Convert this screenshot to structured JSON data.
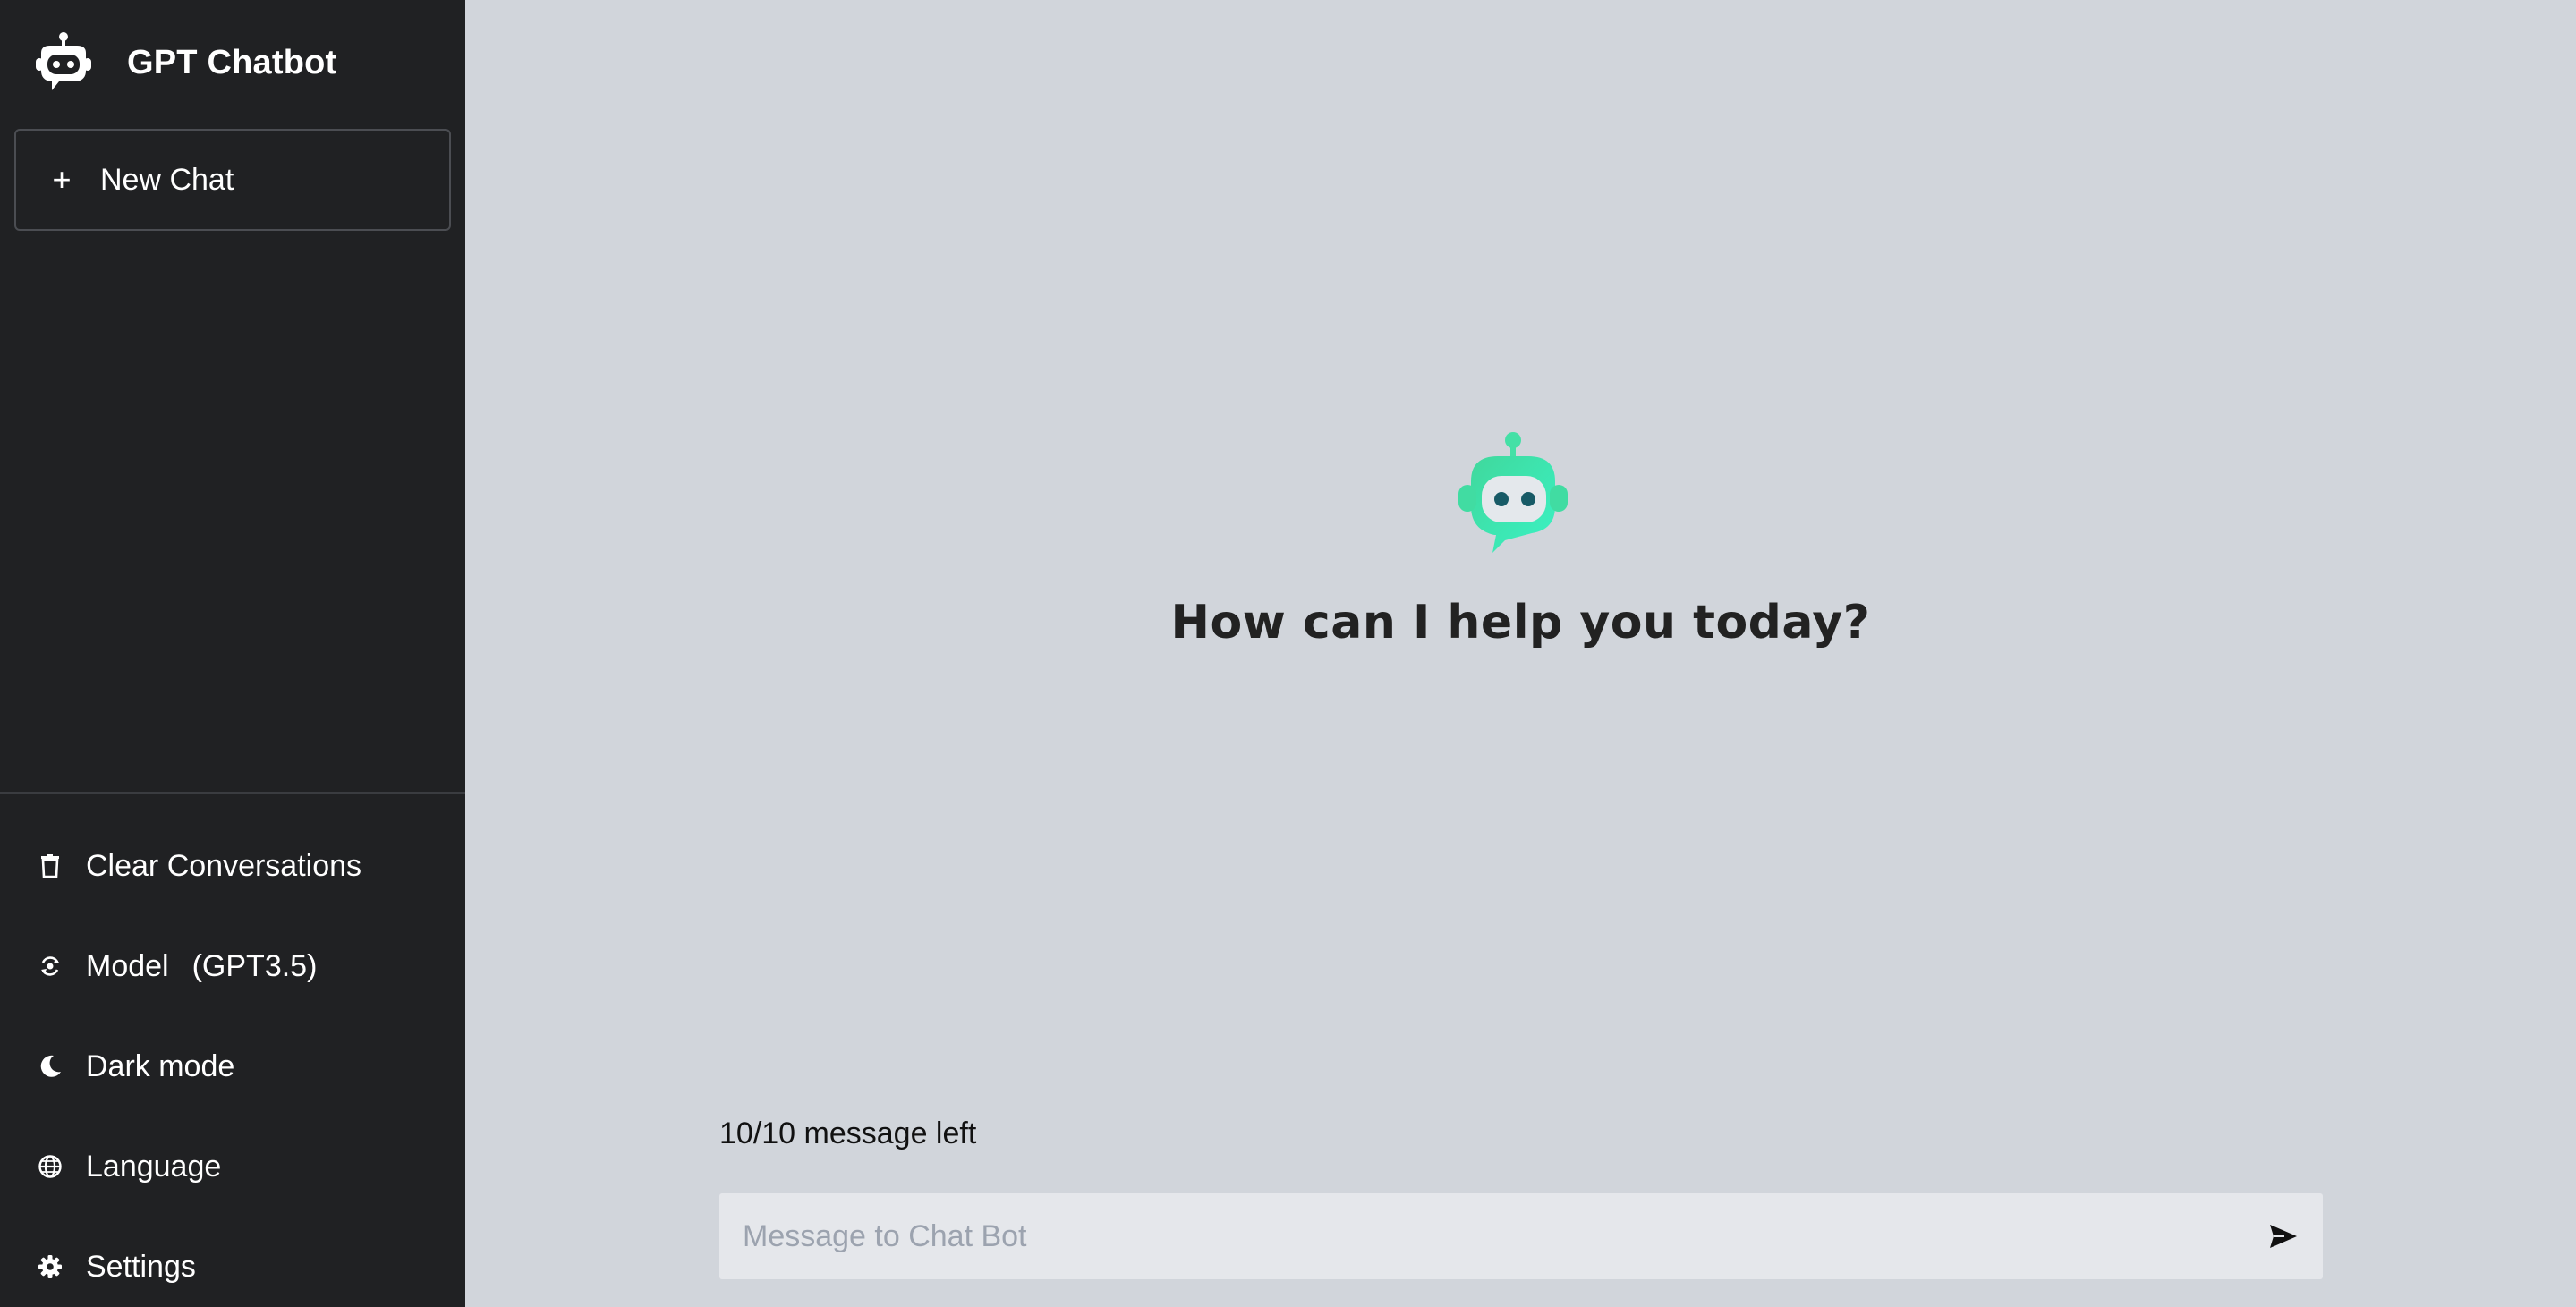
{
  "app": {
    "title": "GPT Chatbot",
    "logo_icon": "robot-chat-icon"
  },
  "sidebar": {
    "new_chat": {
      "icon": "plus-icon",
      "label": "New Chat"
    },
    "bottom_items": [
      {
        "icon": "trash-icon",
        "label": "Clear Conversations"
      },
      {
        "icon": "model-switch-icon",
        "label": "Model",
        "value": "(GPT3.5)"
      },
      {
        "icon": "moon-icon",
        "label": "Dark mode"
      },
      {
        "icon": "globe-icon",
        "label": "Language"
      },
      {
        "icon": "gear-icon",
        "label": "Settings"
      }
    ]
  },
  "main": {
    "hero_icon": "robot-chat-icon",
    "hero_title": "How can I help you today?",
    "counter": "10/10 message left",
    "composer": {
      "placeholder": "Message to Chat Bot",
      "value": "",
      "send_icon": "send-icon"
    }
  },
  "colors": {
    "sidebar_bg": "#202123",
    "main_bg": "#d1d5db",
    "accent": "#3eeab8",
    "input_bg": "#e5e7eb"
  }
}
